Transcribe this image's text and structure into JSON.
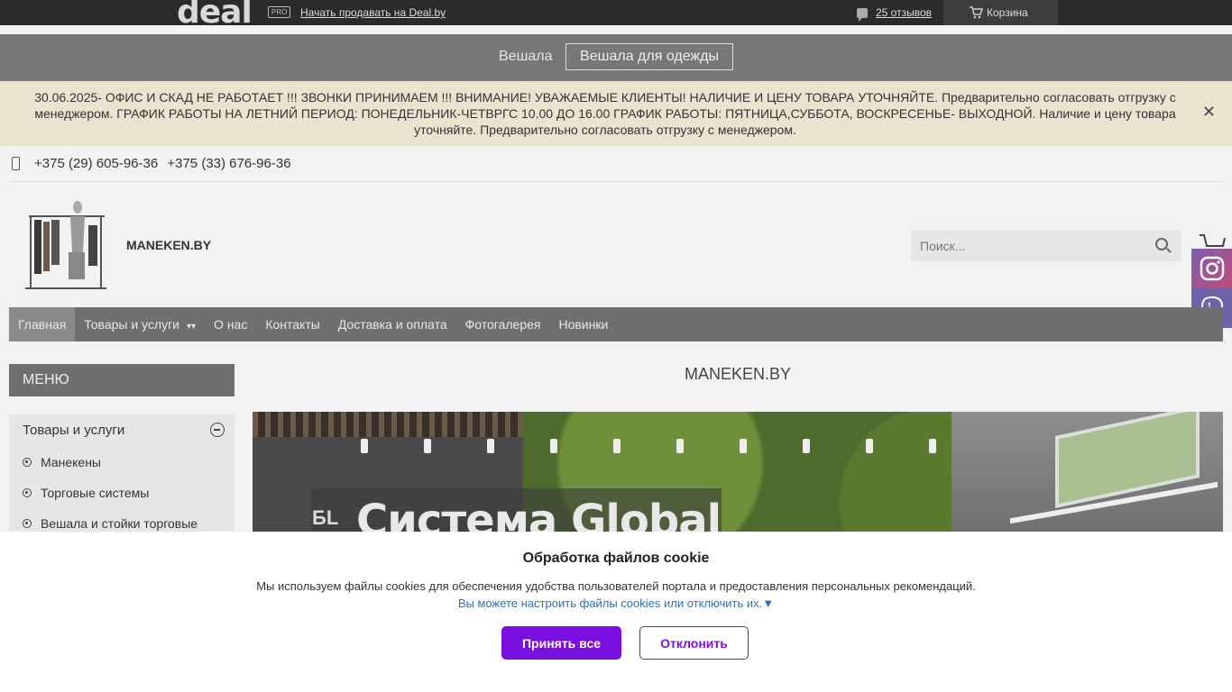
{
  "dealbar": {
    "logo_text": "deal",
    "pro_badge": "PRO",
    "sell_link": "Начать продавать на Deal.by",
    "reviews": "25 отзывов",
    "cart": "Корзина"
  },
  "category_bar": {
    "parent": "Вешала",
    "current": "Вешала для одежды"
  },
  "notice": {
    "text": "30.06.2025- ОФИС И СКАД НЕ РАБОТАЕТ !!! ЗВОНКИ ПРИНИМАЕМ !!! ВНИМАНИЕ! УВАЖАЕМЫЕ КЛИЕНТЫ! НАЛИЧИЕ И ЦЕНУ ТОВАРА УТОЧНЯЙТЕ. Предварительно согласовать отгрузку с менеджером. ГРАФИК РАБОТЫ НА ЛЕТНИЙ ПЕРИОД: ПОНЕДЕЛЬНИК-ЧЕТВРГС 10.00 ДО 16.00 ГРАФИК РАБОТЫ: ПЯТНИЦА,СУББОТА, ВОСКРЕСЕНЬЕ- ВЫХОДНОЙ. Наличие и цену товара уточняйте. Предварительно согласовать отгрузку с менеджером.",
    "close": "✕"
  },
  "phones": [
    "+375 (29) 605-96-36",
    "+375 (33) 676-96-36"
  ],
  "header": {
    "brand": "MANEKEN.BY",
    "search_placeholder": "Поиск..."
  },
  "nav": {
    "items": [
      "Главная",
      "Товары и услуги",
      "О нас",
      "Контакты",
      "Доставка и оплата",
      "Фотогалерея",
      "Новинки"
    ]
  },
  "sidebar": {
    "title": "МЕНЮ",
    "category": "Товары и услуги",
    "items": [
      "Манекены",
      "Торговые системы",
      "Вешала и стойки торговые"
    ]
  },
  "main": {
    "title": "MANEKEN.BY",
    "banner_text": "Система Global",
    "banner_mini": "БL"
  },
  "cookie": {
    "title": "Обработка файлов cookie",
    "description": "Мы используем файлы cookies для обеспечения удобства пользователей портала и предоставления персональных рекомендаций.",
    "configure": "Вы можете настроить файлы cookies или отключить их.▼",
    "accept": "Принять все",
    "decline": "Отклонить"
  }
}
